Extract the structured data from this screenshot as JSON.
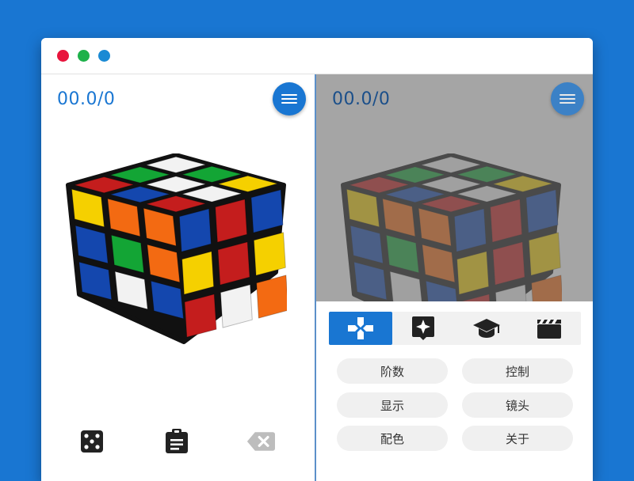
{
  "colors": {
    "accent": "#1976d2",
    "timer_left": "#1976d2",
    "dot_red": "#e8143c",
    "dot_green": "#1eb14a",
    "dot_blue": "#1a8ad4",
    "cube_white": "#f2f2f2",
    "cube_yellow": "#f5d000",
    "cube_red": "#c41d1d",
    "cube_orange": "#f36a12",
    "cube_blue": "#1447ae",
    "cube_green": "#13a535",
    "icon_dark": "#222222",
    "icon_grey": "#bdbdbd"
  },
  "left_pane": {
    "timer": "00.0/0",
    "menu_icon": "menu-icon",
    "bottom_icons": [
      "dice-icon",
      "clipboard-icon",
      "backspace-icon"
    ]
  },
  "right_pane": {
    "timer": "00.0/0",
    "menu_icon": "menu-icon",
    "tabs": [
      {
        "icon": "gamepad-icon",
        "active": true
      },
      {
        "icon": "sparkle-bubble-icon",
        "active": false
      },
      {
        "icon": "graduation-cap-icon",
        "active": false
      },
      {
        "icon": "clapperboard-icon",
        "active": false
      }
    ],
    "options": [
      "阶数",
      "控制",
      "显示",
      "镜头",
      "配色",
      "关于"
    ]
  },
  "cube": {
    "top": [
      [
        "R",
        "G",
        "W"
      ],
      [
        "B",
        "W",
        "G"
      ],
      [
        "R",
        "W",
        "Y"
      ]
    ],
    "left": [
      [
        "Y",
        "O",
        "O"
      ],
      [
        "B",
        "G",
        "O"
      ],
      [
        "B",
        "W",
        "B"
      ]
    ],
    "right": [
      [
        "B",
        "R",
        "B"
      ],
      [
        "Y",
        "R",
        "Y"
      ],
      [
        "R",
        "W",
        "O"
      ]
    ]
  }
}
